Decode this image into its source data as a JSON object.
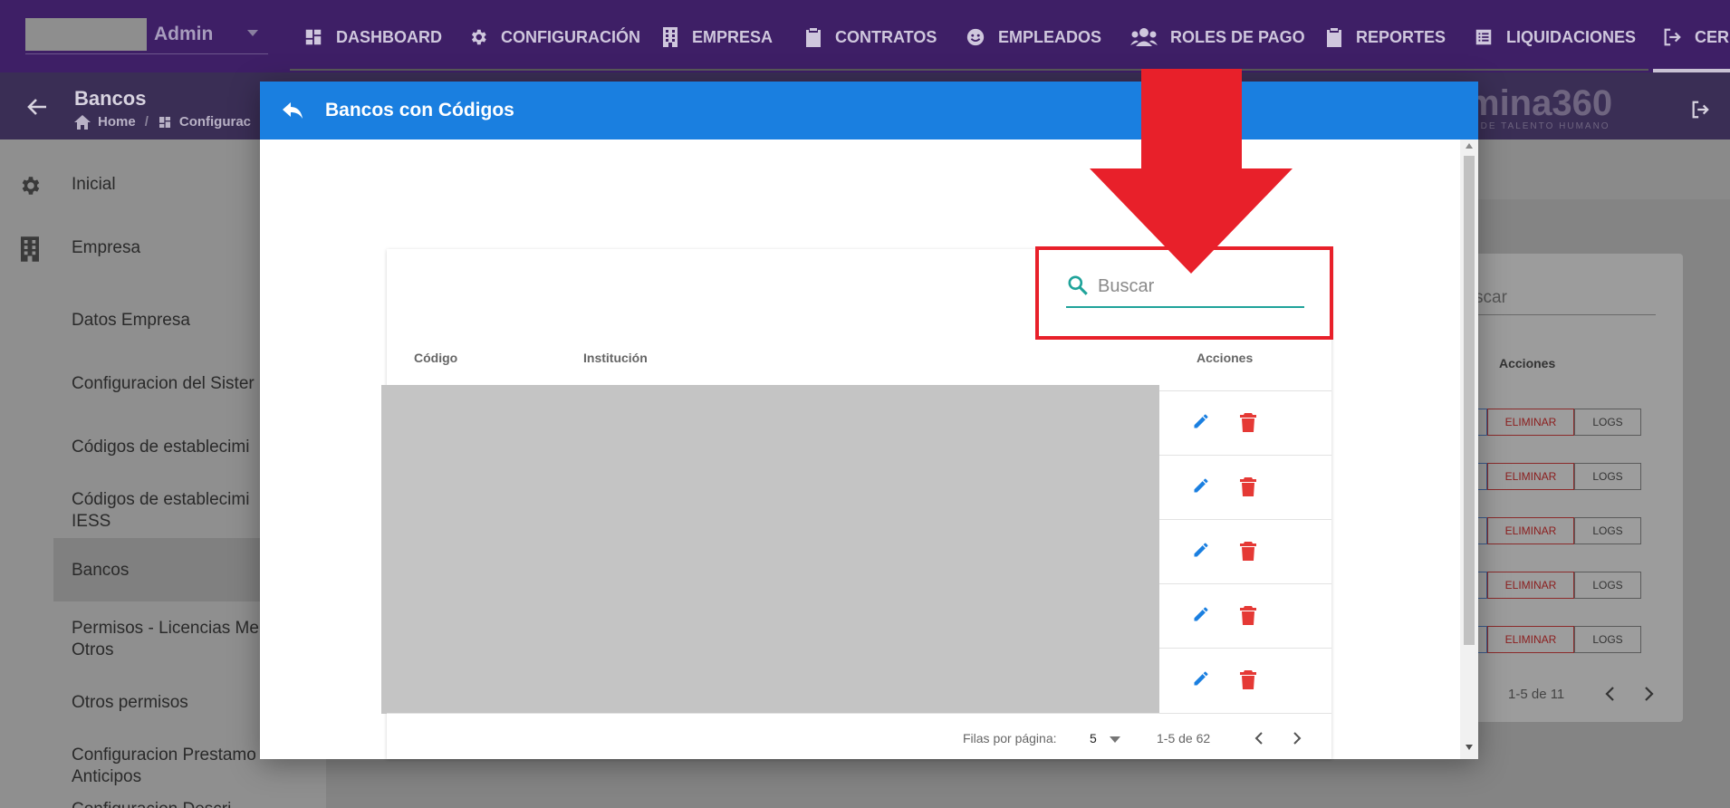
{
  "topnav": {
    "user": "Admin",
    "items": [
      {
        "label": "DASHBOARD",
        "icon": "dashboard-icon"
      },
      {
        "label": "CONFIGURACIÓN",
        "icon": "gear-icon"
      },
      {
        "label": "EMPRESA",
        "icon": "building-icon"
      },
      {
        "label": "CONTRATOS",
        "icon": "clipboard-icon"
      },
      {
        "label": "EMPLEADOS",
        "icon": "face-icon"
      },
      {
        "label": "ROLES DE PAGO",
        "icon": "people-icon"
      },
      {
        "label": "REPORTES",
        "icon": "report-icon"
      },
      {
        "label": "LIQUIDACIONES",
        "icon": "list-icon"
      },
      {
        "label": "CER",
        "icon": "logout-icon"
      }
    ]
  },
  "subheader": {
    "title": "Bancos",
    "breadcrumb": [
      "Home",
      "Configurac"
    ],
    "brand": "mina360",
    "brand_sub": "RE DE TALENTO HUMANO"
  },
  "sidebar": {
    "items": [
      {
        "label": "Inicial"
      },
      {
        "label": "Empresa"
      },
      {
        "label": "Datos Empresa"
      },
      {
        "label": "Configuracion del Sister"
      },
      {
        "label": "Códigos de establecimi"
      },
      {
        "label": "Códigos de establecimi"
      },
      {
        "label": "IESS"
      },
      {
        "label": "Bancos"
      },
      {
        "label": "Permisos - Licencias Me"
      },
      {
        "label": "Otros"
      },
      {
        "label": "Otros permisos"
      },
      {
        "label": "Configuracion Prestamo"
      },
      {
        "label": "Anticipos"
      },
      {
        "label": "Configuracion Descri"
      }
    ]
  },
  "background_table": {
    "search_placeholder": "scar",
    "actions_header": "Acciones",
    "delete_label": "ELIMINAR",
    "logs_label": "LOGS",
    "pagination": "1-5 de 11"
  },
  "modal": {
    "title": "Bancos con Códigos",
    "search_placeholder": "Buscar",
    "columns": {
      "code": "Código",
      "institution": "Institución",
      "actions": "Acciones"
    },
    "row_count": 5,
    "footer": {
      "rows_per_page_label": "Filas por página:",
      "rows_per_page_value": "5",
      "range": "1-5 de 62"
    }
  },
  "colors": {
    "modal_header": "#1a7fe0",
    "highlight": "#e8202a",
    "edit_icon": "#1a7fe0",
    "delete_icon": "#e53935",
    "search_underline": "#1fa39a"
  }
}
